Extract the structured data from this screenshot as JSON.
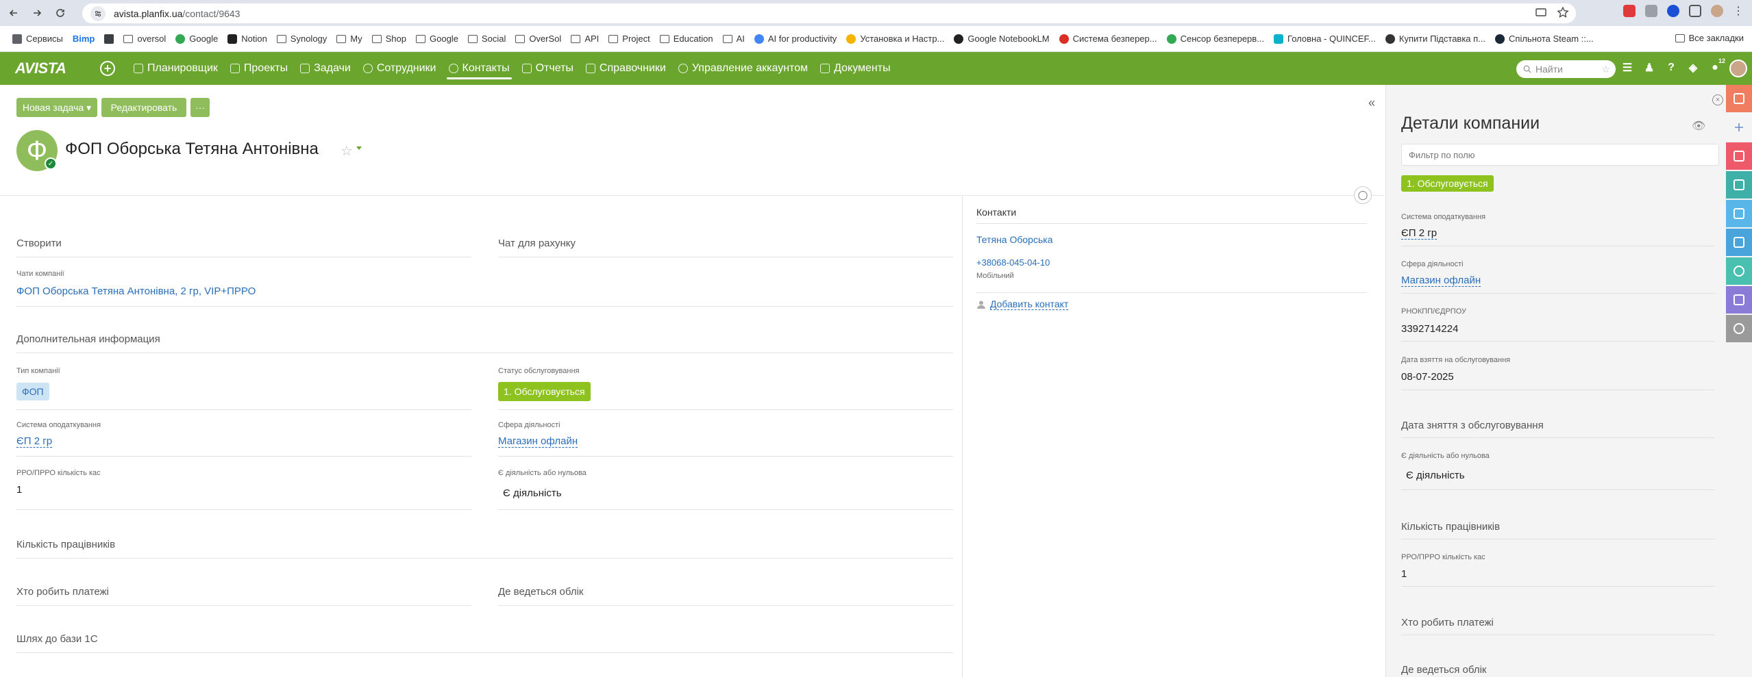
{
  "browser": {
    "url_host": "avista.planfix.ua",
    "url_path": "/contact/9643",
    "bookmarks": [
      "Сервисы",
      "Bimp",
      "oversol",
      "Google",
      "Notion",
      "Synology",
      "My",
      "Shop",
      "Google",
      "Social",
      "OverSol",
      "API",
      "Project",
      "Education",
      "AI",
      "AI for productivity",
      "Установка и Настр...",
      "Google NotebookLM",
      "Система безперер...",
      "Сенсор безперерв...",
      "Головна - QUINCEF...",
      "Купити Підставка п...",
      "Спільнота Steam ::..."
    ],
    "all_bookmarks": "Все закладки"
  },
  "app": {
    "logo": "AVISTA",
    "nav": [
      "Планировщик",
      "Проекты",
      "Задачи",
      "Сотрудники",
      "Контакты",
      "Отчеты",
      "Справочники",
      "Управление аккаунтом",
      "Документы"
    ],
    "search_placeholder": "Найти",
    "notif_count": "12"
  },
  "toolbar": {
    "new_task": "Новая задача ▾",
    "edit": "Редактировать",
    "more": "···"
  },
  "company": {
    "avatar_letter": "Ф",
    "title": "ФОП Оборська Тетяна Антонівна"
  },
  "sections": {
    "create": "Створити",
    "chat_for_invoice": "Чат для рахунку",
    "company_chats_label": "Чати компанії",
    "company_chats_value": "ФОП Оборська Тетяна Антонівна, 2 гр, VIP+ПРРО",
    "additional_info": "Дополнительная информация",
    "company_type_label": "Тип компанії",
    "company_type_value": "ФОП",
    "service_status_label": "Статус обслуговування",
    "service_status_value": "1. Обслуговується",
    "tax_system_label": "Система оподаткування",
    "tax_system_value": "ЄП 2 гр",
    "activity_sphere_label": "Сфера діяльності",
    "activity_sphere_value": "Магазин офлайн",
    "rro_label": "РРО/ПРРО кількість кас",
    "rro_value": "1",
    "activity_or_zero_label": "Є діяльність або нульова",
    "activity_or_zero_value": "Є діяльність",
    "employees": "Кількість працівників",
    "who_pays": "Хто робить платежі",
    "where_accounting": "Де ведеться облік",
    "path_1c": "Шлях до бази 1С"
  },
  "contacts": {
    "title": "Контакти",
    "name": "Тетяна Оборська",
    "phone": "+38068-045-04-10",
    "phone_type": "Мобільний",
    "add_contact": "Добавить контакт"
  },
  "right_panel": {
    "title": "Детали компании",
    "filter_placeholder": "Фильтр по полю",
    "status_value": "1. Обслуговується",
    "tax_label": "Система оподаткування",
    "tax_value": "ЄП 2 гр",
    "sphere_label": "Сфера діяльності",
    "sphere_value": "Магазин офлайн",
    "rnokpp_label": "РНОКПП/ЄДРПОУ",
    "rnokpp_value": "3392714224",
    "start_date_label": "Дата взяття на обслуговування",
    "start_date_value": "08-07-2025",
    "end_date_section": "Дата зняття з обслуговування",
    "activity_label": "Є діяльність або нульова",
    "activity_value": "Є діяльність",
    "employees_section": "Кількість працівників",
    "rro_label": "РРО/ПРРО кількість кас",
    "rro_value": "1",
    "who_pays_section": "Хто робить платежі",
    "where_accounting_section": "Де ведеться облік"
  },
  "colors": {
    "brand_green": "#6aa52e",
    "button_green": "#8fbd5c",
    "status_green": "#8ec31f",
    "link_blue": "#2a6ebb",
    "strip": [
      "#f07d5f",
      "#5b8ed6",
      "#ef5a6b",
      "#3fb0a7",
      "#58b7e8",
      "#4aa4dc",
      "#4ac0b0",
      "#8b7bd8",
      "#9a9a9a"
    ]
  }
}
